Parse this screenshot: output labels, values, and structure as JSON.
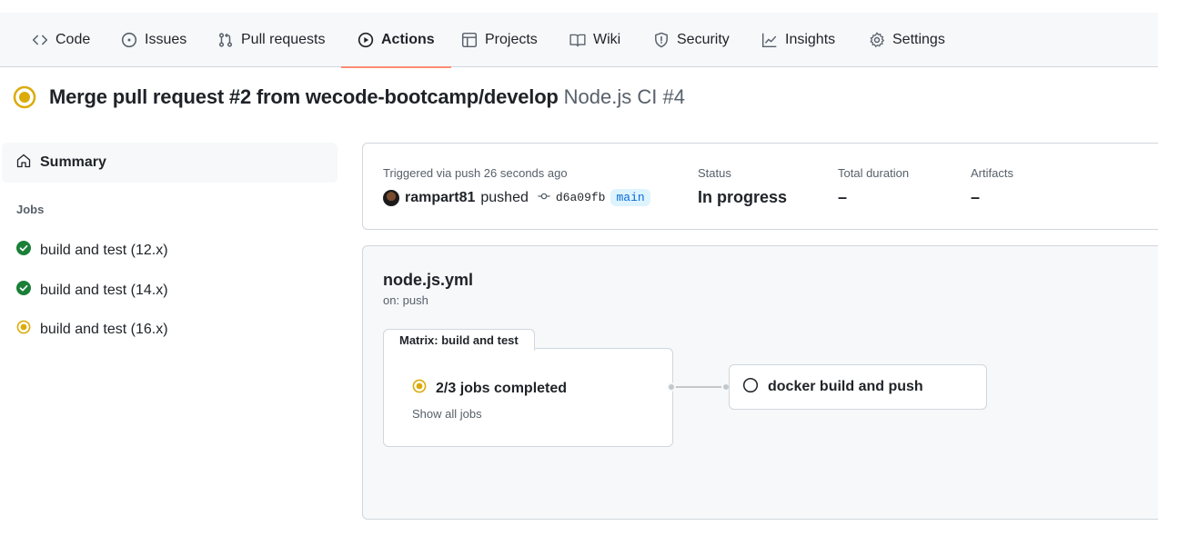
{
  "nav": {
    "items": [
      {
        "label": "Code",
        "icon": "code-icon"
      },
      {
        "label": "Issues",
        "icon": "issue-opened-icon"
      },
      {
        "label": "Pull requests",
        "icon": "git-pull-request-icon"
      },
      {
        "label": "Actions",
        "icon": "play-icon",
        "active": true
      },
      {
        "label": "Projects",
        "icon": "table-icon"
      },
      {
        "label": "Wiki",
        "icon": "book-icon"
      },
      {
        "label": "Security",
        "icon": "shield-icon"
      },
      {
        "label": "Insights",
        "icon": "graph-icon"
      },
      {
        "label": "Settings",
        "icon": "gear-icon"
      }
    ]
  },
  "run": {
    "title": "Merge pull request #2 from wecode-bootcamp/develop",
    "workflow_label": "Node.js CI #4",
    "status_icon": "in-progress-icon"
  },
  "sidebar": {
    "summary_label": "Summary",
    "jobs_heading": "Jobs",
    "jobs": [
      {
        "label": "build and test (12.x)",
        "status": "success"
      },
      {
        "label": "build and test (14.x)",
        "status": "success"
      },
      {
        "label": "build and test (16.x)",
        "status": "in_progress"
      }
    ]
  },
  "summary": {
    "trigger_text": "Triggered via push 26 seconds ago",
    "actor": "rampart81",
    "action": "pushed",
    "commit_sha": "d6a09fb",
    "branch": "main",
    "status_label": "Status",
    "status_value": "In progress",
    "duration_label": "Total duration",
    "duration_value": "–",
    "artifacts_label": "Artifacts",
    "artifacts_value": "–"
  },
  "graph": {
    "workflow_file": "node.js.yml",
    "trigger": "on: push",
    "matrix_label": "Matrix: build and test",
    "matrix_progress": "2/3 jobs completed",
    "show_all_label": "Show all jobs",
    "downstream_job": "docker build and push"
  },
  "colors": {
    "success": "#1a7f37",
    "in_progress": "#bf8700",
    "accent_underline": "#fd8c73",
    "link": "#0969da"
  }
}
